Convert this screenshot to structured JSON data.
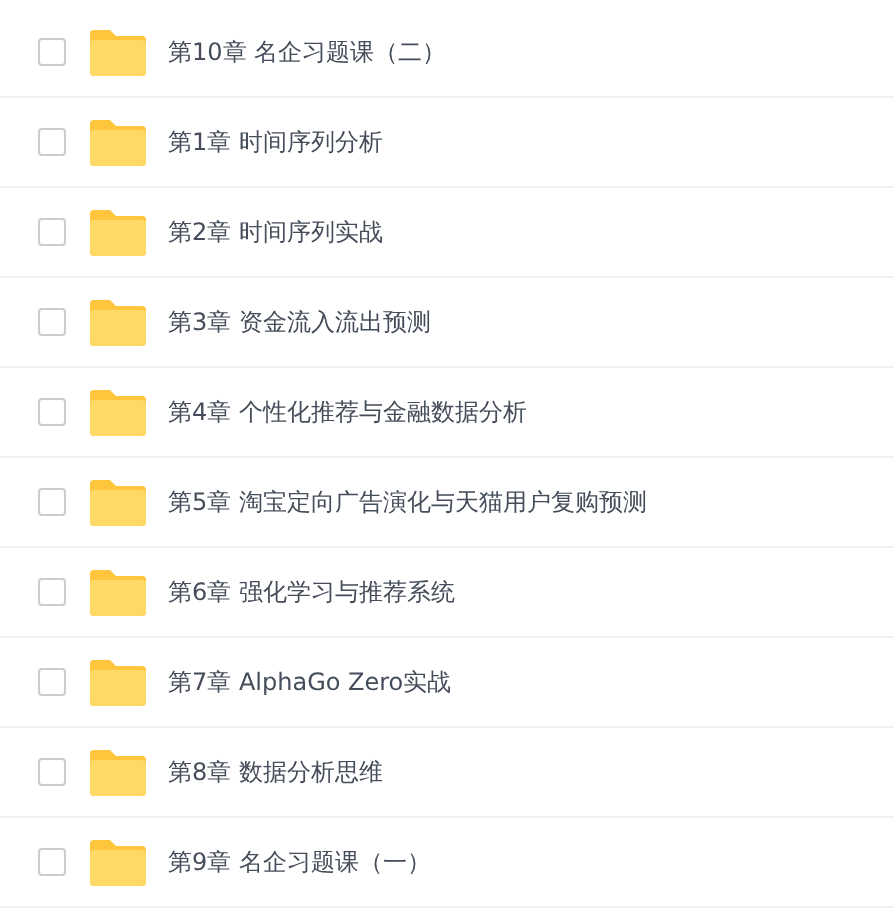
{
  "files": [
    {
      "name": "第10章 名企习题课（二）",
      "checked": false
    },
    {
      "name": "第1章 时间序列分析",
      "checked": false
    },
    {
      "name": "第2章 时间序列实战",
      "checked": false
    },
    {
      "name": "第3章 资金流入流出预测",
      "checked": false
    },
    {
      "name": "第4章 个性化推荐与金融数据分析",
      "checked": false
    },
    {
      "name": "第5章 淘宝定向广告演化与天猫用户复购预测",
      "checked": false
    },
    {
      "name": "第6章 强化学习与推荐系统",
      "checked": false
    },
    {
      "name": "第7章 AlphaGo Zero实战",
      "checked": false
    },
    {
      "name": "第8章 数据分析思维",
      "checked": false
    },
    {
      "name": "第9章 名企习题课（一）",
      "checked": false
    }
  ]
}
